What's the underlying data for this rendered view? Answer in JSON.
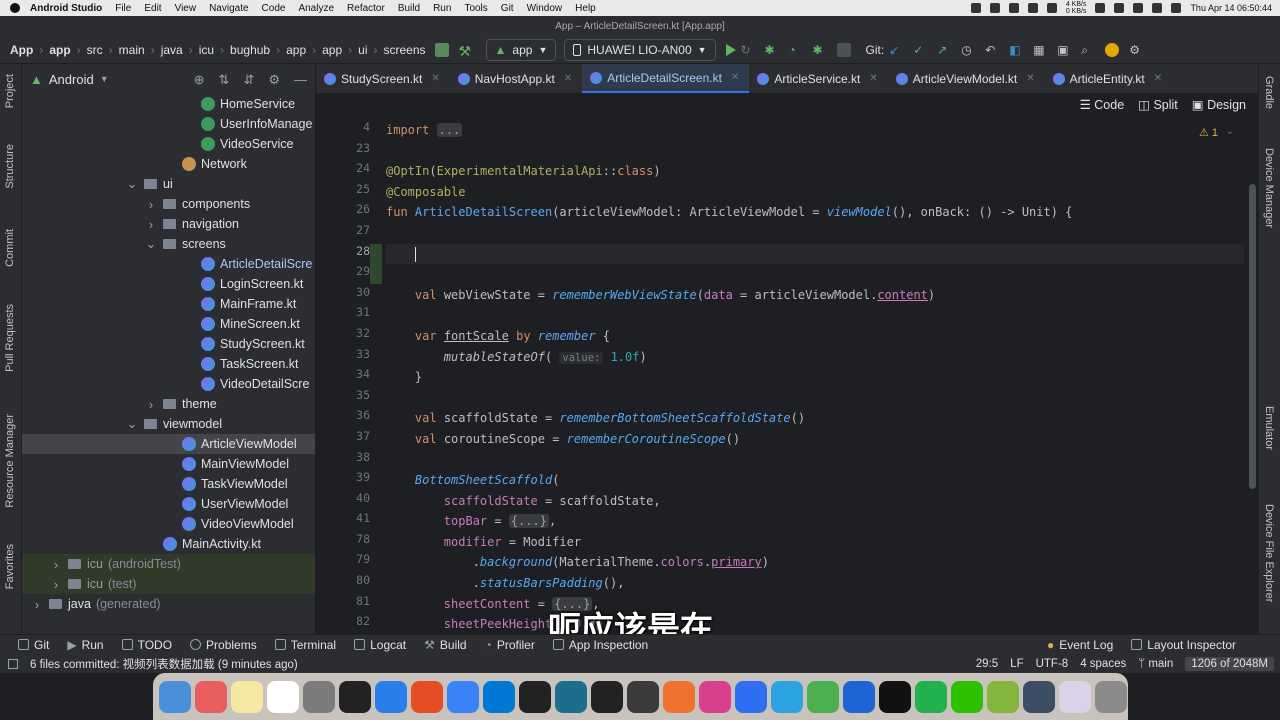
{
  "menubar": {
    "items": [
      "Android Studio",
      "File",
      "Edit",
      "View",
      "Navigate",
      "Code",
      "Analyze",
      "Refactor",
      "Build",
      "Run",
      "Tools",
      "Git",
      "Window",
      "Help"
    ],
    "net_up": "4 KB/s",
    "net_down": "0 KB/s",
    "clock": "Thu Apr 14  06:50:44"
  },
  "window": {
    "title": "App – ArticleDetailScreen.kt [App.app]"
  },
  "toolbar": {
    "crumbs": [
      "App",
      "app",
      "src",
      "main",
      "java",
      "icu",
      "bughub",
      "app",
      "app",
      "ui",
      "screens"
    ],
    "run_config": "app",
    "device": "HUAWEI LIO-AN00",
    "git_label": "Git:"
  },
  "left_stripe": [
    "Project",
    "Structure",
    "Commit",
    "Pull Requests",
    "Resource Manager",
    "Favorites"
  ],
  "right_stripe": [
    "Gradle",
    "Device Manager",
    "Emulator",
    "Device File Explorer"
  ],
  "project": {
    "view_label": "Android",
    "tree": [
      {
        "label": "HomeService",
        "indent": 9,
        "icon": "svc"
      },
      {
        "label": "UserInfoManage",
        "indent": 9,
        "icon": "svc"
      },
      {
        "label": "VideoService",
        "indent": 9,
        "icon": "svc"
      },
      {
        "label": "Network",
        "indent": 8,
        "icon": "net"
      },
      {
        "label": "ui",
        "indent": 6,
        "icon": "folder",
        "arrow": "open"
      },
      {
        "label": "components",
        "indent": 7,
        "icon": "folder",
        "arrow": "closed"
      },
      {
        "label": "navigation",
        "indent": 7,
        "icon": "folder",
        "arrow": "closed"
      },
      {
        "label": "screens",
        "indent": 7,
        "icon": "folder",
        "arrow": "open"
      },
      {
        "label": "ArticleDetailScre",
        "indent": 9,
        "icon": "kt",
        "style": "active"
      },
      {
        "label": "LoginScreen.kt",
        "indent": 9,
        "icon": "kt"
      },
      {
        "label": "MainFrame.kt",
        "indent": 9,
        "icon": "kt"
      },
      {
        "label": "MineScreen.kt",
        "indent": 9,
        "icon": "kt"
      },
      {
        "label": "StudyScreen.kt",
        "indent": 9,
        "icon": "kt"
      },
      {
        "label": "TaskScreen.kt",
        "indent": 9,
        "icon": "kt"
      },
      {
        "label": "VideoDetailScre",
        "indent": 9,
        "icon": "kt"
      },
      {
        "label": "theme",
        "indent": 7,
        "icon": "folder",
        "arrow": "closed"
      },
      {
        "label": "viewmodel",
        "indent": 6,
        "icon": "folder",
        "arrow": "open"
      },
      {
        "label": "ArticleViewModel",
        "indent": 8,
        "icon": "kt",
        "style": "sel"
      },
      {
        "label": "MainViewModel",
        "indent": 8,
        "icon": "kt"
      },
      {
        "label": "TaskViewModel",
        "indent": 8,
        "icon": "kt"
      },
      {
        "label": "UserViewModel",
        "indent": 8,
        "icon": "kt"
      },
      {
        "label": "VideoViewModel",
        "indent": 8,
        "icon": "kt"
      },
      {
        "label": "MainActivity.kt",
        "indent": 7,
        "icon": "kt"
      },
      {
        "label": "icu",
        "suffix": "(androidTest)",
        "indent": 2,
        "icon": "folder",
        "arrow": "closed",
        "style": "dim"
      },
      {
        "label": "icu",
        "suffix": "(test)",
        "indent": 2,
        "icon": "folder",
        "arrow": "closed",
        "style": "dim"
      },
      {
        "label": "java",
        "suffix": "(generated)",
        "indent": 1,
        "icon": "folder",
        "arrow": "closed"
      }
    ]
  },
  "tabs": [
    {
      "label": "StudyScreen.kt"
    },
    {
      "label": "NavHostApp.kt"
    },
    {
      "label": "ArticleDetailScreen.kt",
      "active": true
    },
    {
      "label": "ArticleService.kt"
    },
    {
      "label": "ArticleViewModel.kt"
    },
    {
      "label": "ArticleEntity.kt"
    }
  ],
  "editor": {
    "view_modes": [
      "Code",
      "Split",
      "Design"
    ],
    "warning_count": "1",
    "line_numbers": [
      "4",
      "23",
      "24",
      "25",
      "26",
      "27",
      "28",
      "29",
      "30",
      "31",
      "32",
      "33",
      "34",
      "35",
      "36",
      "37",
      "38",
      "39",
      "40",
      "41",
      "78",
      "79",
      "80",
      "81",
      "82"
    ]
  },
  "subtitle": "呃应该是在",
  "bottom_tools": [
    "Git",
    "Run",
    "TODO",
    "Problems",
    "Terminal",
    "Logcat",
    "Build",
    "Profiler",
    "App Inspection",
    "Event Log",
    "Layout Inspector"
  ],
  "status": {
    "message": "6 files committed: 视频列表数据加载 (9 minutes ago)",
    "position": "29:5",
    "line_sep": "LF",
    "encoding": "UTF-8",
    "indent": "4 spaces",
    "branch": "main",
    "memory": "1206 of 2048M"
  },
  "dock_colors": [
    "#4a90d9",
    "#e85d5d",
    "#f5e8a3",
    "#ffffff",
    "#7b7b7b",
    "#222222",
    "#2b7de9",
    "#e44d26",
    "#3b82f6",
    "#0078d4",
    "#222222",
    "#1c6e8c",
    "#222222",
    "#3a3a3a",
    "#f0722e",
    "#d93f8b",
    "#2d6ff0",
    "#2aa3e0",
    "#4caf50",
    "#1e64d2",
    "#111111",
    "#22b14c",
    "#2dc100",
    "#84b63e",
    "#3c4e64",
    "#d9d2e8",
    "#8a8a8a"
  ]
}
